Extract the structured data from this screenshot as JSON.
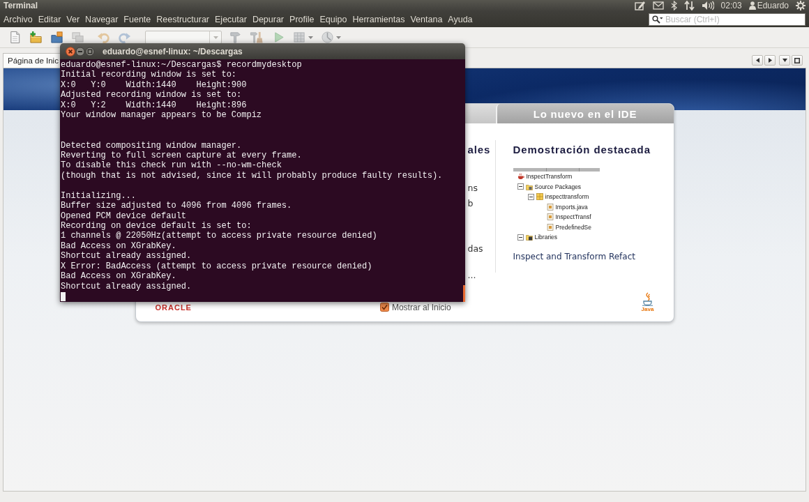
{
  "top_panel": {
    "app_title": "Terminal",
    "clock": "02:03",
    "user": "Eduardo"
  },
  "menu_bar": {
    "items": [
      "Archivo",
      "Editar",
      "Ver",
      "Navegar",
      "Fuente",
      "Reestructurar",
      "Ejecutar",
      "Depurar",
      "Profile",
      "Equipo",
      "Herramientas",
      "Ventana",
      "Ayuda"
    ],
    "search": {
      "placeholder": "Buscar (Ctrl+I)"
    }
  },
  "toolbar": {
    "items": [
      {
        "kind": "newfile",
        "disabled": false
      },
      {
        "kind": "newproject",
        "disabled": false
      },
      {
        "kind": "openproject",
        "disabled": false
      },
      {
        "kind": "closeproject",
        "disabled": true
      },
      {
        "kind": "undo",
        "disabled": true
      },
      {
        "kind": "redo",
        "disabled": true
      },
      {
        "kind": "combo",
        "disabled": true
      },
      {
        "kind": "build",
        "disabled": true
      },
      {
        "kind": "clean",
        "disabled": true
      },
      {
        "kind": "run",
        "disabled": true
      },
      {
        "kind": "debug",
        "disabled": true
      },
      {
        "kind": "profile",
        "disabled": true
      }
    ]
  },
  "editor_tabs": [
    {
      "label": "Página de Inic",
      "selected": true
    }
  ],
  "start_page": {
    "card_tabs": [
      {
        "label": "Lo nuevo en el IDE",
        "selected": false
      }
    ],
    "left_column": {
      "heading": "ales",
      "links": [
        "ns",
        "b",
        "das",
        "..."
      ]
    },
    "featured": {
      "heading": "Demostración destacada",
      "tree": [
        {
          "label": "InspectTransform",
          "kind": "project",
          "children": [
            {
              "label": "Source Packages",
              "kind": "folder",
              "expanded": true,
              "children": [
                {
                  "label": "inspecttransform",
                  "kind": "package",
                  "expanded": true,
                  "children": [
                    {
                      "label": "Imports.java",
                      "kind": "file"
                    },
                    {
                      "label": "InspectTransf",
                      "kind": "file"
                    },
                    {
                      "label": "PredefinedSe",
                      "kind": "file"
                    }
                  ]
                }
              ]
            },
            {
              "label": "Libraries",
              "kind": "library",
              "expanded": true
            }
          ]
        }
      ],
      "caption": "Inspect and Transform Refact"
    },
    "footer": {
      "logo": "ORACLE",
      "show_on_startup": {
        "label": "Mostrar al Inicio",
        "checked": true
      },
      "java_logo": "Java"
    }
  },
  "terminal": {
    "title": "eduardo@esnef-linux: ~/Descargas",
    "lines": [
      {
        "kind": "text",
        "text": "eduardo@esnef-linux:~/Descargas$ recordmydesktop"
      },
      {
        "kind": "text",
        "text": "Initial recording window is set to:"
      },
      {
        "kind": "text",
        "text": "X:0   Y:0    Width:1440    Height:900"
      },
      {
        "kind": "text",
        "text": "Adjusted recording window is set to:"
      },
      {
        "kind": "text",
        "text": "X:0   Y:2    Width:1440    Height:896"
      },
      {
        "kind": "text",
        "text": "Your window manager appears to be Compiz"
      },
      {
        "kind": "blank"
      },
      {
        "kind": "blank"
      },
      {
        "kind": "text",
        "text": "Detected compositing window manager."
      },
      {
        "kind": "text",
        "text": "Reverting to full screen capture at every frame."
      },
      {
        "kind": "text",
        "text": "To disable this check run with --no-wm-check"
      },
      {
        "kind": "text",
        "text": "(though that is not advised, since it will probably produce faulty results)."
      },
      {
        "kind": "blank"
      },
      {
        "kind": "text",
        "text": "Initializing..."
      },
      {
        "kind": "text",
        "text": "Buffer size adjusted to 4096 from 4096 frames."
      },
      {
        "kind": "text",
        "text": "Opened PCM device default"
      },
      {
        "kind": "text",
        "text": "Recording on device default is set to:"
      },
      {
        "kind": "text",
        "text": "1 channels @ 22050Hz(attempt to access private resource denied)"
      },
      {
        "kind": "text",
        "text": "Bad Access on XGrabKey."
      },
      {
        "kind": "text",
        "text": "Shortcut already assigned."
      },
      {
        "kind": "text",
        "text": "X Error: BadAccess (attempt to access private resource denied)"
      },
      {
        "kind": "text",
        "text": "Bad Access on XGrabKey."
      },
      {
        "kind": "text",
        "text": "Shortcut already assigned."
      }
    ]
  }
}
